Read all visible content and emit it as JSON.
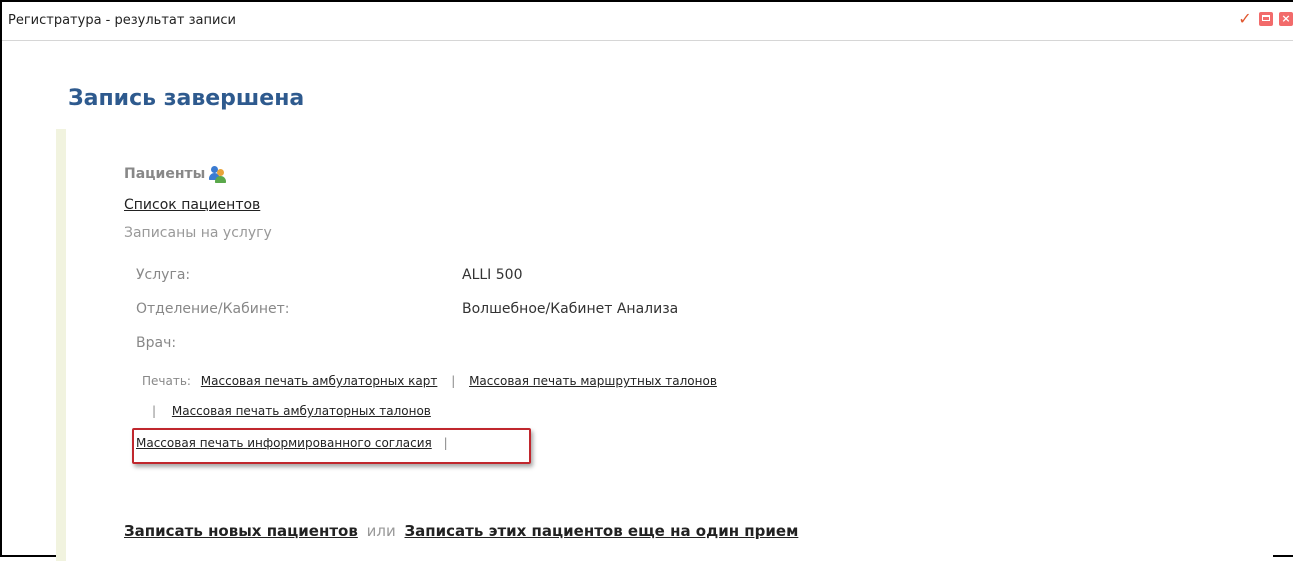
{
  "window": {
    "title": "Регистратура - результат записи"
  },
  "page": {
    "heading": "Запись завершена"
  },
  "patients": {
    "title": "Пациенты",
    "list_link": "Список пациентов",
    "subtitle": "Записаны на услугу"
  },
  "details": {
    "service_label": "Услуга:",
    "service_value": "ALLI 500",
    "department_label": "Отделение/Кабинет:",
    "department_value": "Волшебное/Кабинет Анализа",
    "doctor_label": "Врач:"
  },
  "print": {
    "label": "Печать:",
    "links": [
      "Массовая печать амбулаторных карт",
      "Массовая печать маршрутных талонов",
      "Массовая печать амбулаторных талонов",
      "Массовая печать информированного согласия"
    ],
    "separator": "|"
  },
  "actions": {
    "new_patients": "Записать новых пациентов",
    "or": "или",
    "again": "Записать этих пациентов еще на один прием"
  },
  "colors": {
    "heading": "#2e5a8e",
    "highlight": "#c0272d",
    "accent_bar": "#f1f3df"
  }
}
